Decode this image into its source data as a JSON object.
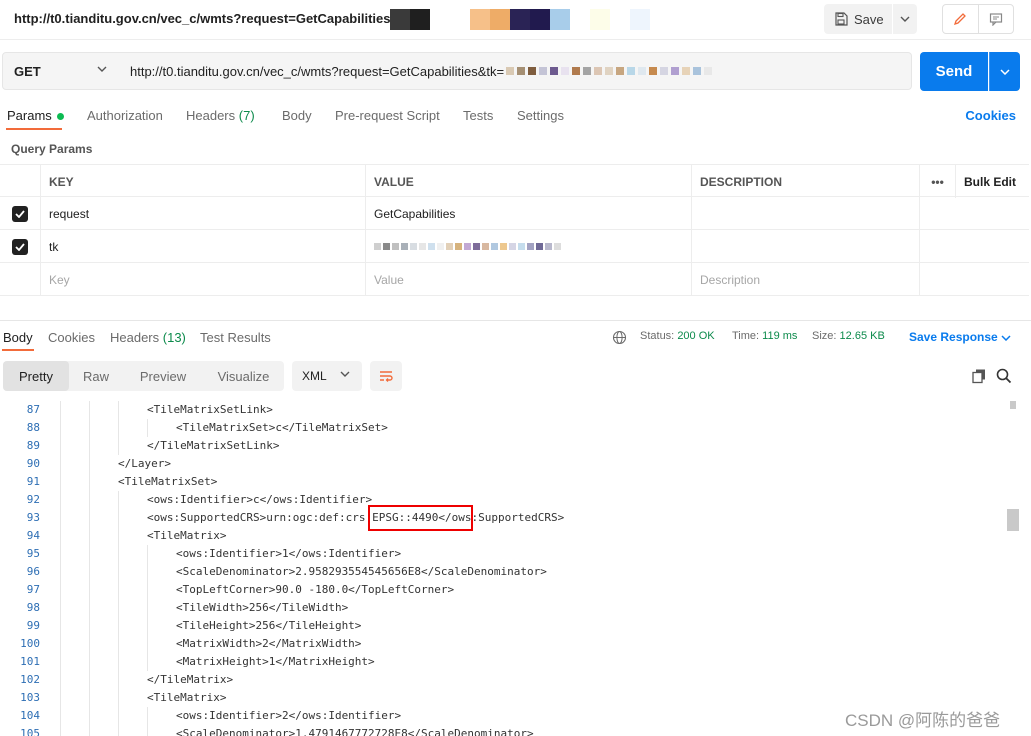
{
  "window": {
    "title": "http://t0.tianditu.gov.cn/vec_c/wmts?request=GetCapabilities&t",
    "save_label": "Save"
  },
  "request": {
    "method": "GET",
    "url": "http://t0.tianditu.gov.cn/vec_c/wmts?request=GetCapabilities&tk=",
    "send_label": "Send"
  },
  "request_tabs": {
    "params": "Params",
    "authorization": "Authorization",
    "headers": "Headers",
    "headers_count": "(7)",
    "body": "Body",
    "pre_request": "Pre-request Script",
    "tests": "Tests",
    "settings": "Settings",
    "cookies": "Cookies"
  },
  "query_params": {
    "label": "Query Params",
    "columns": {
      "key": "KEY",
      "value": "VALUE",
      "description": "DESCRIPTION",
      "more": "•••",
      "bulk_edit": "Bulk Edit"
    },
    "rows": [
      {
        "key": "request",
        "value": "GetCapabilities",
        "checked": true
      },
      {
        "key": "tk",
        "value": "",
        "checked": true
      }
    ],
    "placeholders": {
      "key": "Key",
      "value": "Value",
      "description": "Description"
    }
  },
  "response": {
    "tabs": {
      "body": "Body",
      "cookies": "Cookies",
      "headers": "Headers",
      "headers_count": "(13)",
      "test_results": "Test Results"
    },
    "status_label": "Status:",
    "status_value": "200 OK",
    "time_label": "Time:",
    "time_value": "119 ms",
    "size_label": "Size:",
    "size_value": "12.65 KB",
    "save_response": "Save Response",
    "view_modes": {
      "pretty": "Pretty",
      "raw": "Raw",
      "preview": "Preview",
      "visualize": "Visualize"
    },
    "format": "XML"
  },
  "code": {
    "lines": [
      {
        "no": "87",
        "indent": 3,
        "text": "<TileMatrixSetLink>"
      },
      {
        "no": "88",
        "indent": 4,
        "text": "<TileMatrixSet>c</TileMatrixSet>"
      },
      {
        "no": "89",
        "indent": 3,
        "text": "</TileMatrixSetLink>"
      },
      {
        "no": "90",
        "indent": 2,
        "text": "</Layer>"
      },
      {
        "no": "91",
        "indent": 2,
        "text": "<TileMatrixSet>"
      },
      {
        "no": "92",
        "indent": 3,
        "text": "<ows:Identifier>c</ows:Identifier>"
      },
      {
        "no": "93",
        "indent": 3,
        "text": "<ows:SupportedCRS>urn:ogc:def:crs:EPSG::4490</ows:SupportedCRS>"
      },
      {
        "no": "94",
        "indent": 3,
        "text": "<TileMatrix>"
      },
      {
        "no": "95",
        "indent": 4,
        "text": "<ows:Identifier>1</ows:Identifier>"
      },
      {
        "no": "96",
        "indent": 4,
        "text": "<ScaleDenominator>2.958293554545656E8</ScaleDenominator>"
      },
      {
        "no": "97",
        "indent": 4,
        "text": "<TopLeftCorner>90.0 -180.0</TopLeftCorner>"
      },
      {
        "no": "98",
        "indent": 4,
        "text": "<TileWidth>256</TileWidth>"
      },
      {
        "no": "99",
        "indent": 4,
        "text": "<TileHeight>256</TileHeight>"
      },
      {
        "no": "100",
        "indent": 4,
        "text": "<MatrixWidth>2</MatrixWidth>"
      },
      {
        "no": "101",
        "indent": 4,
        "text": "<MatrixHeight>1</MatrixHeight>"
      },
      {
        "no": "102",
        "indent": 3,
        "text": "</TileMatrix>"
      },
      {
        "no": "103",
        "indent": 3,
        "text": "<TileMatrix>"
      },
      {
        "no": "104",
        "indent": 4,
        "text": "<ows:Identifier>2</ows:Identifier>"
      },
      {
        "no": "105",
        "indent": 4,
        "text": "<ScaleDenominator>1.4791467772728E8</ScaleDenominator>"
      }
    ]
  },
  "watermark": "CSDN @阿陈的爸爸",
  "colors": {
    "accent": "#097bed",
    "active_tab": "#f26b3a",
    "status_ok": "#0c8a4b",
    "highlight": "#ee0000"
  }
}
